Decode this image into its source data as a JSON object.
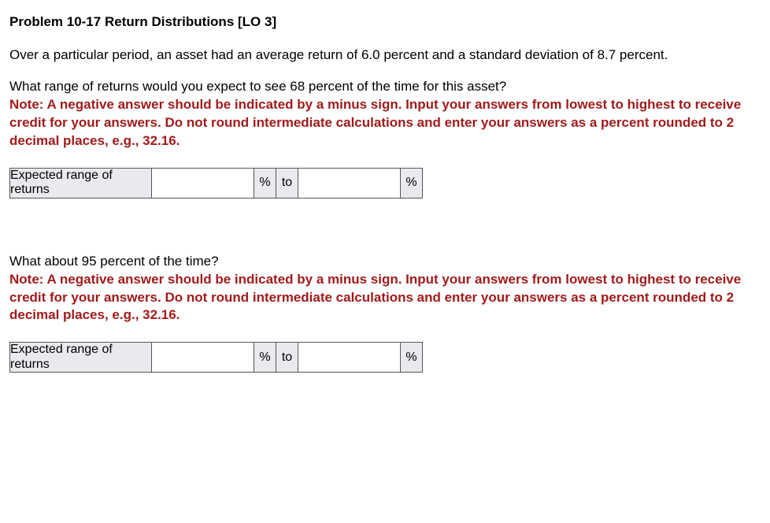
{
  "title": "Problem 10-17 Return Distributions [LO 3]",
  "intro": "Over a particular period, an asset had an average return of 6.0 percent and a standard deviation of 8.7 percent.",
  "q1": {
    "question": "What range of returns would you expect to see 68 percent of the time for this asset?",
    "note": "Note: A negative answer should be indicated by a minus sign. Input your answers from lowest to highest to receive credit for your answers. Do not round intermediate calculations and enter your answers as a percent rounded to 2 decimal places, e.g., 32.16.",
    "label": "Expected range of returns",
    "percent": "%",
    "to": "to",
    "input1": "",
    "input2": ""
  },
  "q2": {
    "question": "What about 95 percent of the time?",
    "note": "Note: A negative answer should be indicated by a minus sign. Input your answers from lowest to highest to receive credit for your answers. Do not round intermediate calculations and enter your answers as a percent rounded to 2 decimal places, e.g., 32.16.",
    "label": "Expected range of returns",
    "percent": "%",
    "to": "to",
    "input1": "",
    "input2": ""
  }
}
